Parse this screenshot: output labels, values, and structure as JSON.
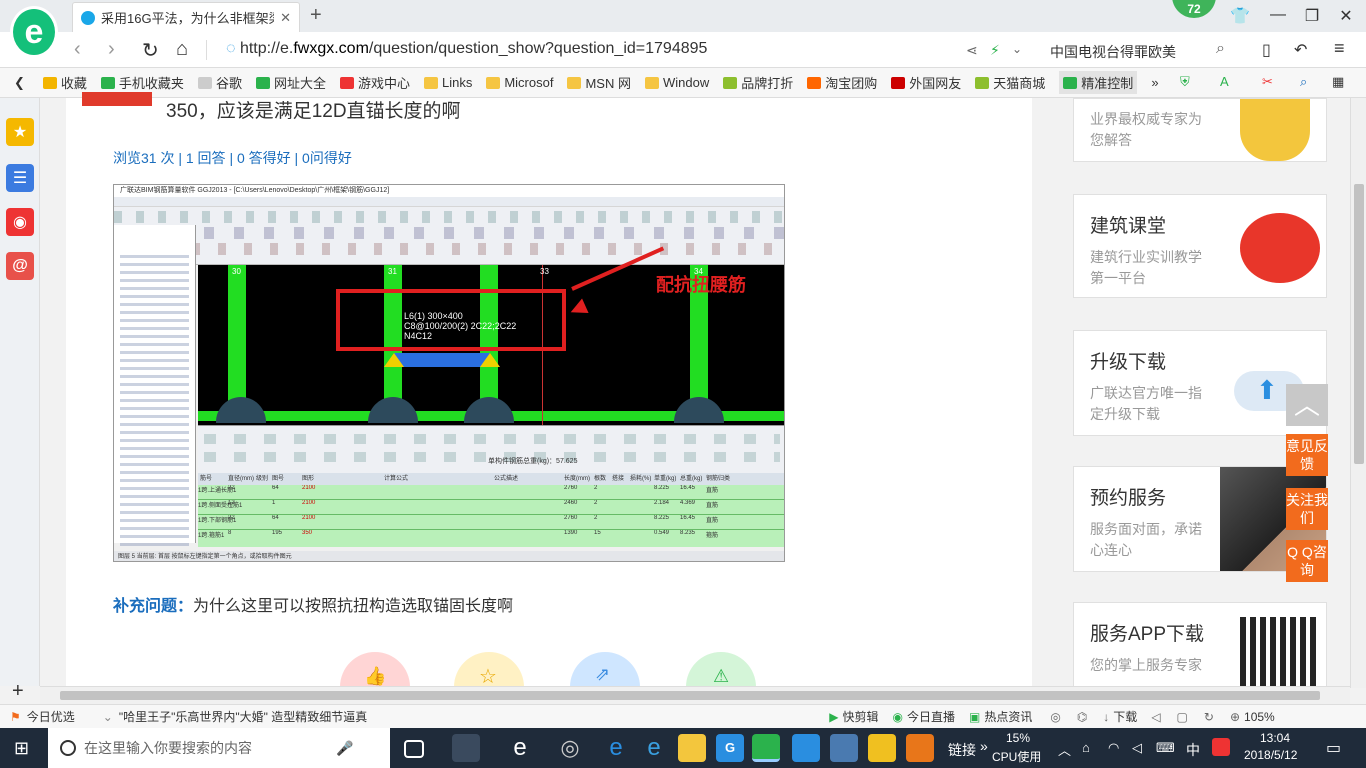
{
  "browser": {
    "tab_title": "采用16G平法，为什么非框架梁下",
    "badge": "72",
    "url_prefix": "http://e.",
    "url_domain": "fwxgx.com",
    "url_path": "/question/question_show?question_id=1794895",
    "search_text": "中国电视台得罪欧美",
    "zoom": "105%"
  },
  "bookmarks": [
    "收藏",
    "手机收藏夹",
    "谷歌",
    "网址大全",
    "游戏中心",
    "Links",
    "Microsof",
    "MSN 网",
    "Window",
    "品牌打折",
    "淘宝团购",
    "外国网友",
    "天猫商城",
    "精准控制"
  ],
  "question": {
    "title": "350，应该是满足12D直锚长度的啊",
    "stats": "浏览31 次 | 1 回答 | 0 答得好 | 0问得好",
    "supplement_label": "补充问题：",
    "supplement_text": "为什么这里可以按照抗扭构造选取锚固长度啊"
  },
  "screenshot": {
    "title": "广联达BIM钢筋算量软件 GGJ2013 - [C:\\Users\\Lenovo\\Desktop\\广州\\框架\\钢筋\\GGJ12]",
    "annotation": "配抗扭腰筋",
    "cad_text_1": "L6(1) 300×400",
    "cad_text_2": "C8@100/200(2) 2C22;2C22",
    "cad_text_3": "N4C12",
    "axis_1": "30",
    "axis_2": "31",
    "axis_3": "33",
    "axis_4": "34",
    "weight": "单构件钢筋总重(kg)：57.625",
    "col_headers": [
      "筋号",
      "直径(mm)",
      "级别",
      "图号",
      "图形",
      "计算公式",
      "公式描述",
      "长度(mm)",
      "根数",
      "搭接",
      "损耗(%)",
      "单重(kg)",
      "总重(kg)",
      "钢筋归类"
    ],
    "rows": [
      {
        "no": "1*",
        "name": "1跨.上通长筋1",
        "dia": "22",
        "code": "64",
        "shape": "2100",
        "len": "2760",
        "qty": "2",
        "unit": "8.225",
        "total": "16.45",
        "type": "直筋"
      },
      {
        "no": "2",
        "name": "1跨.侧面受扭筋1",
        "dia": "12",
        "code": "1",
        "shape": "2100",
        "len": "2460",
        "qty": "2",
        "unit": "2.184",
        "total": "4.369",
        "type": "直筋"
      },
      {
        "no": "3",
        "name": "1跨.下部钢筋1",
        "dia": "22",
        "code": "64",
        "shape": "2100",
        "len": "2760",
        "qty": "2",
        "unit": "8.225",
        "total": "16.45",
        "type": "直筋"
      },
      {
        "no": "4",
        "name": "1跨.箍筋1",
        "dia": "8",
        "code": "195",
        "shape": "350",
        "len": "1390",
        "qty": "15",
        "unit": "0.549",
        "total": "8.235",
        "type": "箍筋"
      }
    ],
    "status": "图层 5    当前层: 首层    按鼠标左键指定第一个角点，或拾取构件图元"
  },
  "sidebar_cards": [
    {
      "title": "",
      "desc": "业界最权威专家为您解答"
    },
    {
      "title": "建筑课堂",
      "desc": "建筑行业实训教学第一平台"
    },
    {
      "title": "升级下载",
      "desc": "广联达官方唯一指定升级下载"
    },
    {
      "title": "预约服务",
      "desc": "服务面对面，承诺心连心"
    },
    {
      "title": "服务APP下载",
      "desc": "您的掌上服务专家"
    }
  ],
  "float_buttons": [
    "意见反馈",
    "关注我们",
    "Q Q咨询"
  ],
  "statusbar": {
    "left": "今日优选",
    "news": "\"哈里王子\"乐高世界内\"大婚\" 造型精致细节逼真",
    "items": [
      "快剪辑",
      "今日直播",
      "热点资讯",
      "下载"
    ]
  },
  "taskbar": {
    "search_placeholder": "在这里输入你要搜索的内容",
    "links": "链接",
    "cpu_pct": "15%",
    "cpu_label": "CPU使用",
    "ime": "中",
    "time": "13:04",
    "date": "2018/5/12"
  },
  "colors": {
    "accent_blue": "#1a6dbd",
    "orange": "#f26b1d",
    "beam_green": "#22dd22",
    "annotation_red": "#e02020"
  }
}
